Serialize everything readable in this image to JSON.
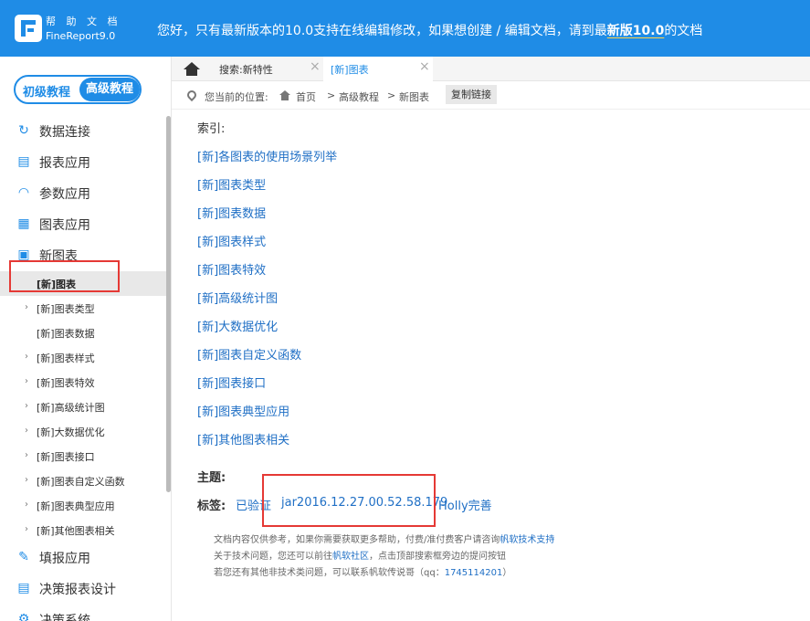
{
  "header": {
    "brand_title": "帮 助 文 档",
    "brand_sub": "FineReport9.0",
    "notice_prefix": "您好，只有最新版本的10.0支持在线编辑修改，如果想创建 / 编辑文档，请到最",
    "notice_link": "新版10.0",
    "notice_suffix": "的文档"
  },
  "level_toggle": {
    "basic": "初级教程",
    "advanced": "高级教程"
  },
  "sidebar": {
    "items": [
      {
        "label": "数据连接",
        "icon": "↻"
      },
      {
        "label": "报表应用",
        "icon": "▤"
      },
      {
        "label": "参数应用",
        "icon": "◠"
      },
      {
        "label": "图表应用",
        "icon": "▦"
      },
      {
        "label": "新图表",
        "icon": "▣"
      }
    ],
    "sub_items": [
      {
        "label": "[新]图表",
        "caret": ""
      },
      {
        "label": "[新]图表类型",
        "caret": "›"
      },
      {
        "label": "[新]图表数据",
        "caret": ""
      },
      {
        "label": "[新]图表样式",
        "caret": "›"
      },
      {
        "label": "[新]图表特效",
        "caret": "›"
      },
      {
        "label": "[新]高级统计图",
        "caret": "›"
      },
      {
        "label": "[新]大数据优化",
        "caret": "›"
      },
      {
        "label": "[新]图表接口",
        "caret": "›"
      },
      {
        "label": "[新]图表自定义函数",
        "caret": "›"
      },
      {
        "label": "[新]图表典型应用",
        "caret": "›"
      },
      {
        "label": "[新]其他图表相关",
        "caret": "›"
      }
    ],
    "bottom_items": [
      {
        "label": "填报应用",
        "icon": "✎"
      },
      {
        "label": "决策报表设计",
        "icon": "▤"
      },
      {
        "label": "决策系统",
        "icon": "⚙"
      }
    ]
  },
  "tabs": [
    {
      "label": "搜索:新特性",
      "close": "×"
    },
    {
      "label": "[新]图表",
      "close": "×"
    }
  ],
  "breadcrumb": {
    "prefix": "您当前的位置:",
    "home": "首页",
    "sep": ">",
    "level": "高级教程",
    "current": "新图表",
    "copy": "复制链接"
  },
  "content": {
    "index_label": "索引:",
    "links": [
      "[新]各图表的使用场景列举",
      "[新]图表类型",
      "[新]图表数据",
      "[新]图表样式",
      "[新]图表特效",
      "[新]高级统计图",
      "[新]大数据优化",
      "[新]图表自定义函数",
      "[新]图表接口",
      "[新]图表典型应用",
      "[新]其他图表相关"
    ],
    "topic_label": "主题:",
    "tags_label": "标签:",
    "tags": [
      "已验证",
      "jar2016.12.27.00.52.58.179",
      "Holly完善"
    ],
    "footer": {
      "line1_prefix": "文档内容仅供参考，如果你需要获取更多帮助，付费/准付费客户请咨询",
      "line1_link": "帆软技术支持",
      "line2_prefix": "关于技术问题，您还可以前往",
      "line2_link": "帆软社区",
      "line2_suffix": "，点击顶部搜索框旁边的提问按钮",
      "line3_prefix": "若您还有其他非技术类问题，可以联系帆软传说哥（qq：",
      "line3_link": "1745114201",
      "line3_suffix": "）"
    }
  },
  "colors": {
    "brand": "#1f8ce6",
    "link": "#1f6fc5",
    "highlight": "#e53935"
  }
}
